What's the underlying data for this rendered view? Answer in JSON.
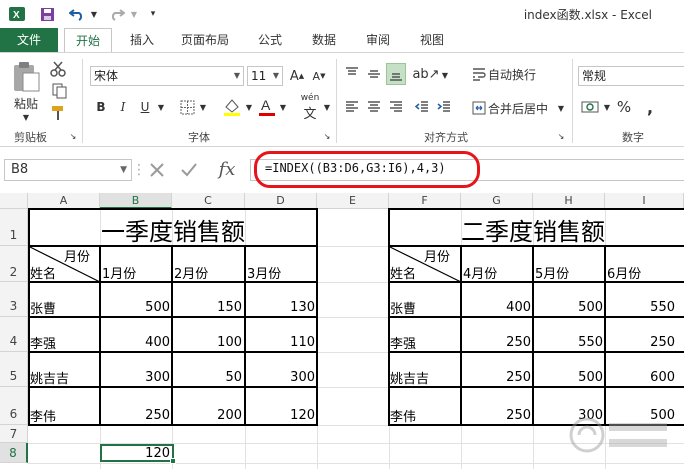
{
  "app": {
    "doc_title": "index函数.xlsx - Excel"
  },
  "tabs": [
    "文件",
    "开始",
    "插入",
    "页面布局",
    "公式",
    "数据",
    "审阅",
    "视图"
  ],
  "ribbon": {
    "paste_label": "粘贴",
    "clipboard_label": "剪贴板",
    "font_name": "宋体",
    "font_size": "11",
    "font_group_label": "字体",
    "bold": "B",
    "italic": "I",
    "underline": "U",
    "phonetic": "wén",
    "wrap_text": "自动换行",
    "merge_center": "合并后居中",
    "align_group_label": "对齐方式",
    "number_format": "常规",
    "number_group_label": "数字",
    "percent": "%",
    "comma": ","
  },
  "formula_bar": {
    "name_box": "B8",
    "fx": "fx",
    "formula": "=INDEX((B3:D6,G3:I6),4,3)"
  },
  "grid": {
    "columns": [
      "A",
      "B",
      "C",
      "D",
      "E",
      "F",
      "G",
      "H",
      "I"
    ],
    "rows": [
      "1",
      "2",
      "3",
      "4",
      "5",
      "6",
      "7",
      "8"
    ],
    "selected_column": "B",
    "selected_row": "8"
  },
  "table1": {
    "title": "一季度销售额",
    "header_top": "月份",
    "header_bottom": "姓名",
    "months": [
      "1月份",
      "2月份",
      "3月份"
    ],
    "rows": [
      {
        "name": "张曹",
        "values": [
          "500",
          "150",
          "130"
        ]
      },
      {
        "name": "李强",
        "values": [
          "400",
          "100",
          "110"
        ]
      },
      {
        "name": "姚吉吉",
        "values": [
          "300",
          "50",
          "300"
        ]
      },
      {
        "name": "李伟",
        "values": [
          "250",
          "200",
          "120"
        ]
      }
    ]
  },
  "table2": {
    "title": "二季度销售额",
    "header_top": "月份",
    "header_bottom": "姓名",
    "months": [
      "4月份",
      "5月份",
      "6月份"
    ],
    "rows": [
      {
        "name": "张曹",
        "values": [
          "400",
          "500",
          "550"
        ]
      },
      {
        "name": "李强",
        "values": [
          "250",
          "550",
          "250"
        ]
      },
      {
        "name": "姚吉吉",
        "values": [
          "250",
          "500",
          "600"
        ]
      },
      {
        "name": "李伟",
        "values": [
          "250",
          "300",
          "500"
        ]
      }
    ]
  },
  "result": {
    "cell": "B8",
    "value": "120"
  },
  "colors": {
    "excel_green": "#217346",
    "highlight_ring": "#e8141b"
  }
}
